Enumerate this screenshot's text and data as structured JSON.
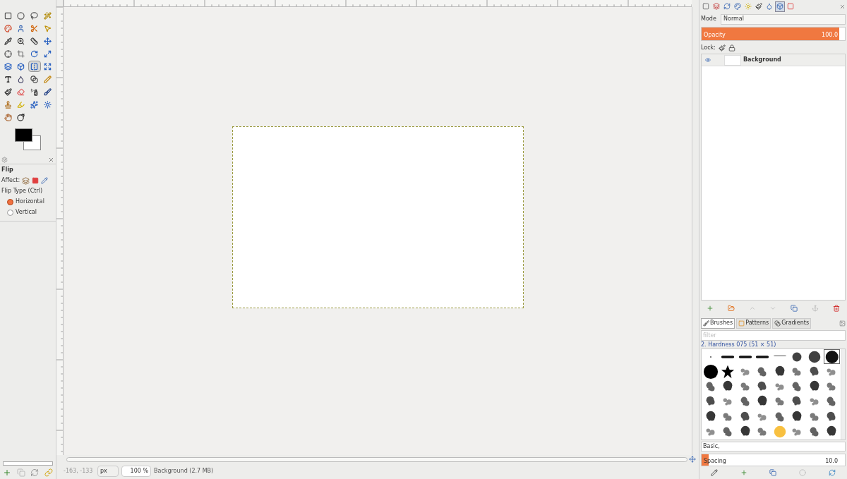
{
  "toolbox": {
    "tools": [
      {
        "selected": false
      },
      {
        "selected": false
      },
      {
        "selected": false
      },
      {
        "selected": false
      },
      {
        "selected": false
      },
      {
        "selected": false
      },
      {
        "selected": false
      },
      {
        "selected": false
      },
      {
        "selected": false
      },
      {
        "selected": false
      },
      {
        "selected": false
      },
      {
        "selected": false
      },
      {
        "selected": false
      },
      {
        "selected": false
      },
      {
        "selected": false
      },
      {
        "selected": false
      },
      {
        "selected": false
      },
      {
        "selected": false
      },
      {
        "selected": true
      },
      {
        "selected": false
      },
      {
        "selected": false
      },
      {
        "selected": false
      },
      {
        "selected": false
      },
      {
        "selected": false
      },
      {
        "selected": false
      },
      {
        "selected": false
      },
      {
        "selected": false
      },
      {
        "selected": false
      },
      {
        "selected": false
      },
      {
        "selected": false
      },
      {
        "selected": false
      },
      {
        "selected": false
      },
      {
        "selected": false
      },
      {
        "selected": false
      }
    ]
  },
  "tool_options": {
    "title": "Flip",
    "affect_label": "Affect:",
    "flip_type_label": "Flip Type (Ctrl)",
    "options": [
      {
        "label": "Horizontal",
        "selected": true
      },
      {
        "label": "Vertical",
        "selected": false
      }
    ]
  },
  "status_bar": {
    "coordinates": "-163, -133",
    "unit": "px",
    "zoom": "100 %",
    "message": "Background (2.7 MB)"
  },
  "layers": {
    "dock_tabs": [
      {
        "selected": false
      },
      {
        "selected": false
      },
      {
        "selected": false
      },
      {
        "selected": false
      },
      {
        "selected": false
      },
      {
        "selected": false
      },
      {
        "selected": false
      },
      {
        "selected": true
      },
      {
        "selected": false
      }
    ],
    "mode_label": "Mode",
    "mode": "Normal",
    "opacity": {
      "label": "Opacity",
      "value": "100.0",
      "level": 1
    },
    "lock_label": "Lock:",
    "items": [
      {
        "name": "Background",
        "visible": true
      }
    ]
  },
  "brushes": {
    "tabs": [
      {
        "label": "Brushes",
        "selected": true
      },
      {
        "label": "Patterns",
        "selected": false
      },
      {
        "label": "Gradients",
        "selected": false
      }
    ],
    "filter_placeholder": "filter",
    "current": "2. Hardness 075 (51 × 51)",
    "grid": [
      {
        "selected": false
      },
      {
        "selected": false
      },
      {
        "selected": false
      },
      {
        "selected": false
      },
      {
        "selected": false
      },
      {
        "selected": false
      },
      {
        "selected": false
      },
      {
        "selected": true
      },
      {
        "selected": false
      },
      {
        "selected": false
      },
      {
        "selected": false
      },
      {
        "selected": false
      },
      {
        "selected": false
      },
      {
        "selected": false
      },
      {
        "selected": false
      },
      {
        "selected": false
      },
      {
        "selected": false
      },
      {
        "selected": false
      },
      {
        "selected": false
      },
      {
        "selected": false
      },
      {
        "selected": false
      },
      {
        "selected": false
      },
      {
        "selected": false
      },
      {
        "selected": false
      },
      {
        "selected": false
      },
      {
        "selected": false
      },
      {
        "selected": false
      },
      {
        "selected": false
      },
      {
        "selected": false
      },
      {
        "selected": false
      },
      {
        "selected": false
      },
      {
        "selected": false
      },
      {
        "selected": false
      },
      {
        "selected": false
      },
      {
        "selected": false
      },
      {
        "selected": false
      },
      {
        "selected": false
      },
      {
        "selected": false
      },
      {
        "selected": false
      },
      {
        "selected": false
      },
      {
        "selected": false
      },
      {
        "selected": false
      },
      {
        "selected": false
      },
      {
        "selected": false
      },
      {
        "selected": false
      },
      {
        "selected": false
      },
      {
        "selected": false
      },
      {
        "selected": false
      }
    ],
    "tag": "Basic,",
    "spacing": {
      "label": "Spacing",
      "value": "10.0",
      "level": 0.05
    }
  }
}
